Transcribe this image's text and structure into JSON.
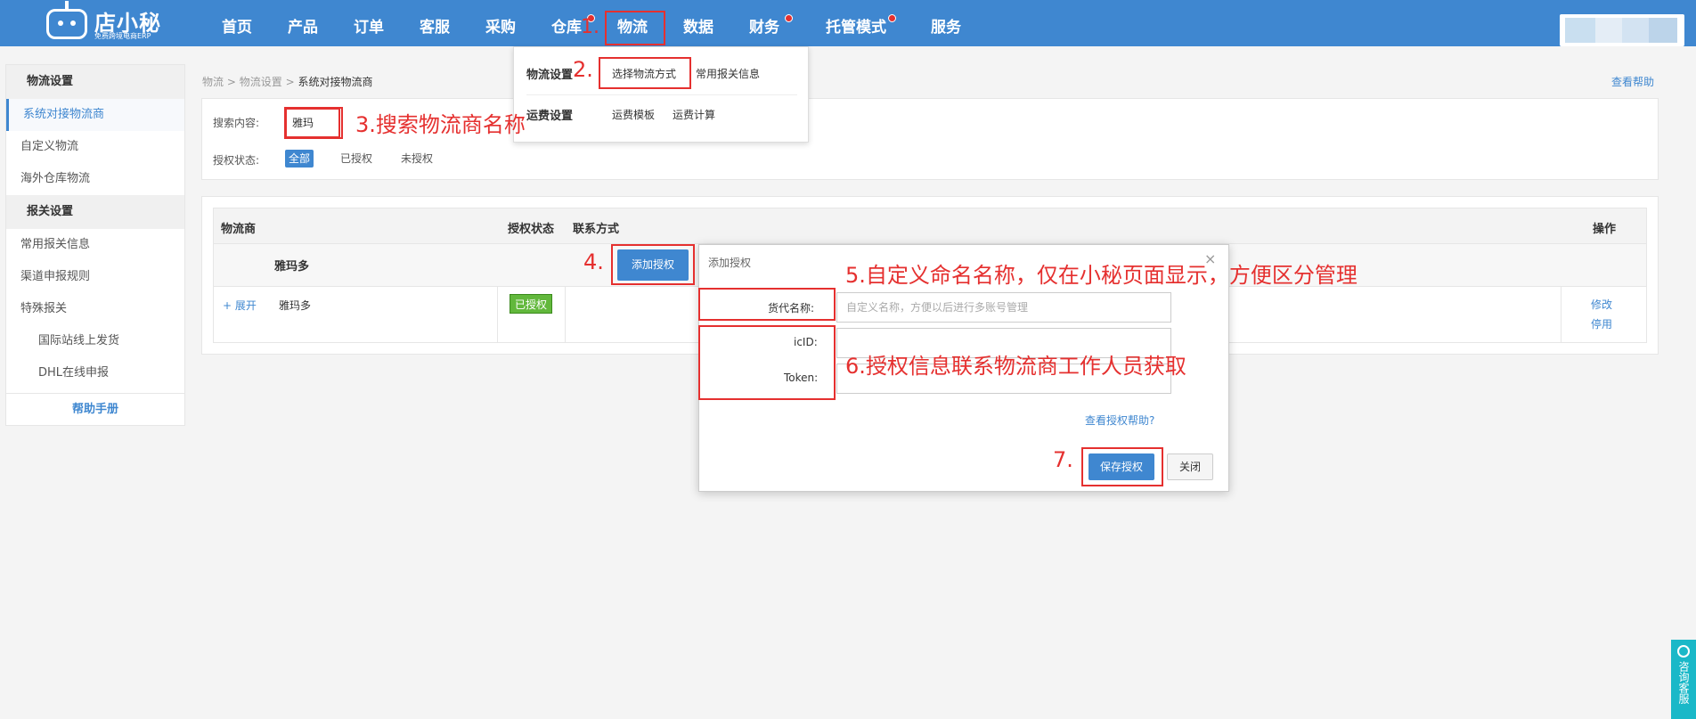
{
  "brand": {
    "name": "店小秘",
    "subtitle": "免费跨境电商ERP"
  },
  "nav": [
    "首页",
    "产品",
    "订单",
    "客服",
    "采购",
    "仓库",
    "物流",
    "数据",
    "财务",
    "托管模式",
    "服务"
  ],
  "sidebar": {
    "group1": "物流设置",
    "items1": [
      "系统对接物流商",
      "自定义物流",
      "海外仓库物流"
    ],
    "group2": "报关设置",
    "items2": [
      "常用报关信息",
      "渠道申报规则",
      "特殊报关"
    ],
    "subitems": [
      "国际站线上发货",
      "DHL在线申报"
    ],
    "help": "帮助手册"
  },
  "breadcrumb": {
    "a": "物流",
    "b": "物流设置",
    "c": "系统对接物流商",
    "sep": ">"
  },
  "help_link": "查看帮助",
  "dropdown": {
    "g1": "物流设置",
    "g1_items": [
      "选择物流方式",
      "常用报关信息"
    ],
    "g2": "运费设置",
    "g2_items": [
      "运费模板",
      "运费计算"
    ]
  },
  "search": {
    "label": "搜索内容:",
    "value": "雅玛",
    "status_label": "授权状态:",
    "status_options": [
      "全部",
      "已授权",
      "未授权"
    ]
  },
  "table": {
    "headers": [
      "物流商",
      "授权状态",
      "联系方式",
      "操作"
    ],
    "group_name": "雅玛多",
    "row": {
      "expand": "+ 展开",
      "name": "雅玛多",
      "status": "已授权",
      "ops": [
        "修改",
        "停用"
      ]
    }
  },
  "add_button": "添加授权",
  "modal": {
    "title": "添加授权",
    "close": "×",
    "field1_label": "货代名称:",
    "field1_placeholder": "自定义名称，方便以后进行多账号管理",
    "field2_label": "icID:",
    "field3_label": "Token:",
    "help": "查看授权帮助?",
    "save": "保存授权",
    "close_btn": "关闭"
  },
  "annotations": {
    "a1": "1.",
    "a2": "2.",
    "a3": "3.搜索物流商名称",
    "a4": "4.",
    "a5": "5.自定义命名名称，仅在小秘页面显示，方便区分管理",
    "a6": "6.授权信息联系物流商工作人员获取",
    "a7": "7."
  },
  "service_tab": "咨询客服",
  "colors": {
    "primary": "#3f87d0",
    "annotation": "#e5302f",
    "authorized": "#62b83c"
  }
}
